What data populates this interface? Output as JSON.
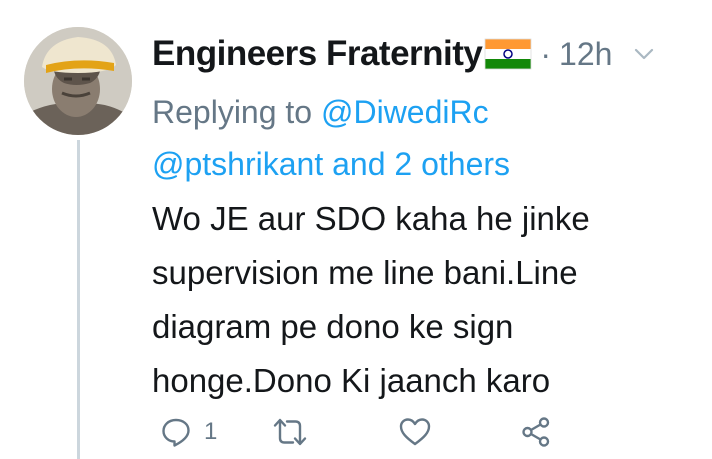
{
  "tweet": {
    "author_name": "Engineers Fraternity",
    "author_flag": "india-flag-emoji",
    "separator": "·",
    "timestamp": "12h",
    "reply_prefix": "Replying to ",
    "reply_mention_1": "@DiwediRc",
    "reply_mention_2": "@ptshrikant and 2 others",
    "text_lines": [
      "Wo JE aur SDO kaha he jinke",
      "supervision me line bani.Line",
      "diagram pe dono ke sign",
      "honge.Dono Ki jaanch karo"
    ]
  },
  "actions": {
    "reply_count": "1",
    "retweet_count": "",
    "like_count": "",
    "icons": [
      "reply-icon",
      "retweet-icon",
      "like-icon",
      "share-icon"
    ]
  },
  "colors": {
    "muted": "#657786",
    "link": "#1da1f2",
    "text": "#14171a",
    "thread_line": "#ccd6dd"
  }
}
